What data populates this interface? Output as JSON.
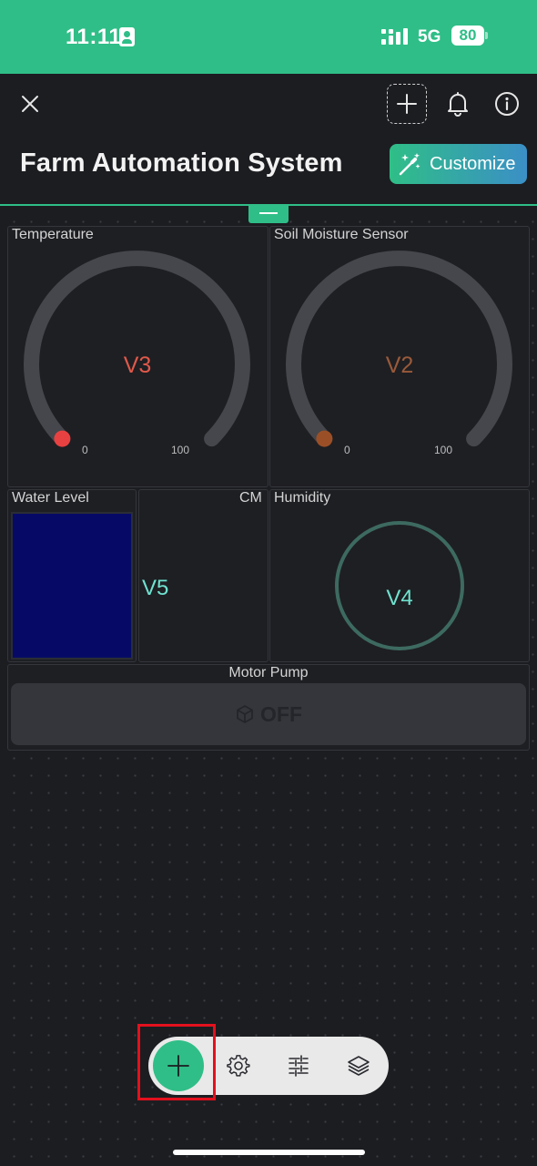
{
  "status_bar": {
    "time": "11:11",
    "network": "5G",
    "battery": "80"
  },
  "header": {
    "title": "Farm Automation System",
    "customize_label": "Customize",
    "icons": [
      "close-icon",
      "add-icon",
      "bell-icon",
      "info-icon",
      "magic-wand-icon"
    ]
  },
  "widgets": {
    "temperature": {
      "label": "Temperature",
      "value": "V3",
      "min": "0",
      "max": "100",
      "value_color": "#e0594a",
      "knob_color": "#e84141"
    },
    "soil_moisture": {
      "label": "Soil Moisture Sensor",
      "value": "V2",
      "min": "0",
      "max": "100",
      "value_color": "#9a5a3a",
      "knob_color": "#9b4f26"
    },
    "water_level": {
      "label": "Water Level",
      "unit": "CM",
      "value": "V5",
      "fill_color": "#060a66"
    },
    "humidity": {
      "label": "Humidity",
      "value": "V4",
      "ring_color": "#3d6a60"
    },
    "motor_pump": {
      "label": "Motor Pump",
      "state": "OFF",
      "icon": "cube-icon"
    }
  },
  "toolbar": {
    "icons": [
      "plus-icon",
      "gear-icon",
      "sliders-icon",
      "layers-icon"
    ]
  },
  "colors": {
    "accent": "#2fbe87",
    "background": "#1c1d21",
    "highlight": "#e3111d"
  }
}
